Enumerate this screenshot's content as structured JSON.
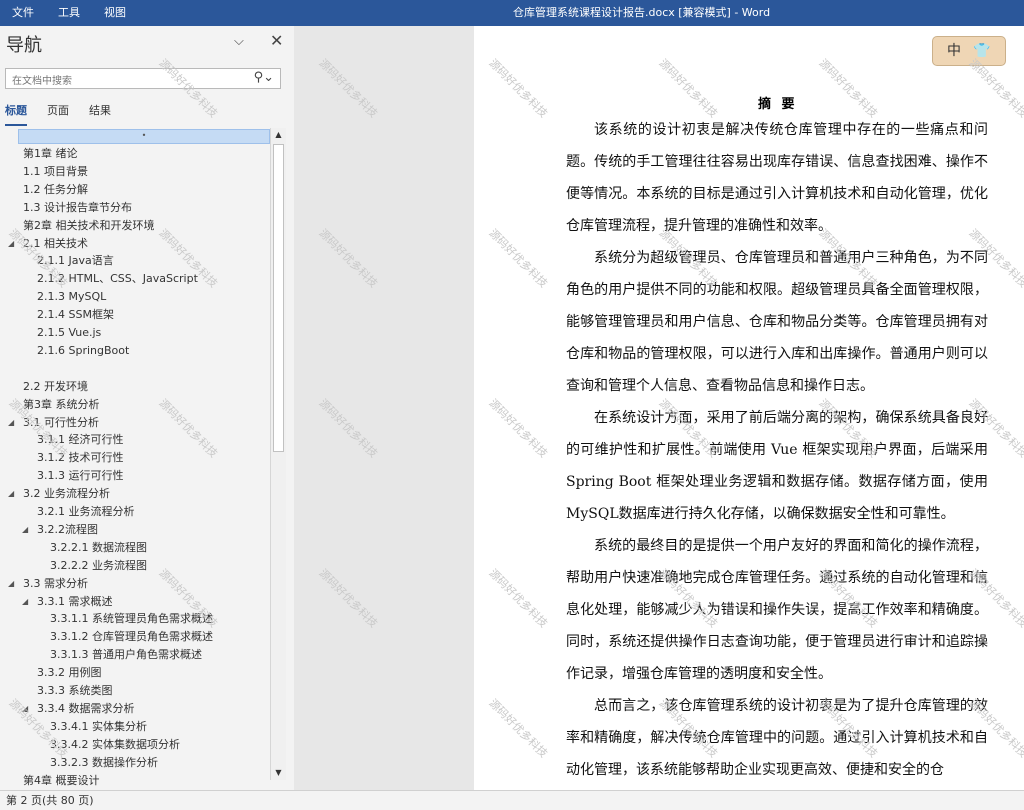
{
  "titlebar": {
    "menu": [
      "文件",
      "工具",
      "视图"
    ],
    "doc_title": "仓库管理系统课程设计报告.docx [兼容模式]  -  Word"
  },
  "nav": {
    "title": "导航",
    "search_placeholder": "在文档中搜索",
    "tabs": [
      "标题",
      "页面",
      "结果"
    ],
    "tree_top_marker": "•",
    "headings": [
      {
        "text": "第1章 绪论",
        "level": 0,
        "expanded": false
      },
      {
        "text": "1.1 项目背景",
        "level": 0,
        "expanded": false
      },
      {
        "text": "1.2 任务分解",
        "level": 0,
        "expanded": false
      },
      {
        "text": "1.3 设计报告章节分布",
        "level": 0,
        "expanded": false
      },
      {
        "text": "第2章 相关技术和开发环境",
        "level": 0,
        "expanded": false
      },
      {
        "text": "2.1 相关技术",
        "level": 0,
        "expanded": true
      },
      {
        "text": "2.1.1 Java语言",
        "level": 1,
        "expanded": false
      },
      {
        "text": "2.1.2 HTML、CSS、JavaScript",
        "level": 1,
        "expanded": false
      },
      {
        "text": "2.1.3 MySQL",
        "level": 1,
        "expanded": false
      },
      {
        "text": "2.1.4 SSM框架",
        "level": 1,
        "expanded": false
      },
      {
        "text": "2.1.5 Vue.js",
        "level": 1,
        "expanded": false
      },
      {
        "text": "2.1.6 SpringBoot",
        "level": 1,
        "expanded": false
      },
      {
        "text": "",
        "level": 0,
        "expanded": false
      },
      {
        "text": "2.2 开发环境",
        "level": 0,
        "expanded": false
      },
      {
        "text": "第3章 系统分析",
        "level": 0,
        "expanded": false
      },
      {
        "text": "3.1 可行性分析",
        "level": 0,
        "expanded": true
      },
      {
        "text": "3.1.1 经济可行性",
        "level": 1,
        "expanded": false
      },
      {
        "text": "3.1.2 技术可行性",
        "level": 1,
        "expanded": false
      },
      {
        "text": "3.1.3 运行可行性",
        "level": 1,
        "expanded": false
      },
      {
        "text": "3.2 业务流程分析",
        "level": 0,
        "expanded": true
      },
      {
        "text": "3.2.1 业务流程分析",
        "level": 1,
        "expanded": false
      },
      {
        "text": "3.2.2流程图",
        "level": 1,
        "expanded": true
      },
      {
        "text": "3.2.2.1 数据流程图",
        "level": 2,
        "expanded": false
      },
      {
        "text": "3.2.2.2 业务流程图",
        "level": 2,
        "expanded": false
      },
      {
        "text": "3.3 需求分析",
        "level": 0,
        "expanded": true
      },
      {
        "text": "3.3.1 需求概述",
        "level": 1,
        "expanded": true
      },
      {
        "text": "3.3.1.1 系统管理员角色需求概述",
        "level": 2,
        "expanded": false
      },
      {
        "text": "3.3.1.2 仓库管理员角色需求概述",
        "level": 2,
        "expanded": false
      },
      {
        "text": "3.3.1.3 普通用户角色需求概述",
        "level": 2,
        "expanded": false
      },
      {
        "text": "3.3.2 用例图",
        "level": 1,
        "expanded": false
      },
      {
        "text": "3.3.3 系统类图",
        "level": 1,
        "expanded": false
      },
      {
        "text": "3.3.4 数据需求分析",
        "level": 1,
        "expanded": true
      },
      {
        "text": "3.3.4.1 实体集分析",
        "level": 2,
        "expanded": false
      },
      {
        "text": "3.3.4.2 实体集数据项分析",
        "level": 2,
        "expanded": false
      },
      {
        "text": "3.3.2.3 数据操作分析",
        "level": 2,
        "expanded": false
      },
      {
        "text": "第4章 概要设计",
        "level": 0,
        "expanded": false
      }
    ]
  },
  "document": {
    "abstract_title": "摘 要",
    "paragraphs": [
      "该系统的设计初衷是解决传统仓库管理中存在的一些痛点和问题。传统的手工管理往往容易出现库存错误、信息查找困难、操作不便等情况。本系统的目标是通过引入计算机技术和自动化管理，优化仓库管理流程，提升管理的准确性和效率。",
      "系统分为超级管理员、仓库管理员和普通用户三种角色，为不同角色的用户提供不同的功能和权限。超级管理员具备全面管理权限，能够管理管理员和用户信息、仓库和物品分类等。仓库管理员拥有对仓库和物品的管理权限，可以进行入库和出库操作。普通用户则可以查询和管理个人信息、查看物品信息和操作日志。",
      "在系统设计方面，采用了前后端分离的架构，确保系统具备良好的可维护性和扩展性。前端使用 Vue 框架实现用户界面，后端采用 Spring Boot 框架处理业务逻辑和数据存储。数据存储方面，使用MySQL数据库进行持久化存储，以确保数据安全性和可靠性。",
      "系统的最终目的是提供一个用户友好的界面和简化的操作流程，帮助用户快速准确地完成仓库管理任务。通过系统的自动化管理和信息化处理，能够减少人为错误和操作失误，提高工作效率和精确度。同时，系统还提供操作日志查询功能，便于管理员进行审计和追踪操作记录，增强仓库管理的透明度和安全性。",
      "总而言之，该仓库管理系统的设计初衷是为了提升仓库管理的效率和精确度，解决传统仓库管理中的问题。通过引入计算机技术和自动化管理，该系统能够帮助企业实现更高效、便捷和安全的仓"
    ]
  },
  "ime": {
    "label": "中",
    "icon": "shirt-icon"
  },
  "watermark": "源码好优多科技",
  "statusbar": {
    "page_info": "第 2 页(共 80 页)"
  },
  "colors": {
    "accent": "#2b579a",
    "nav_selected": "#c5dbf4"
  }
}
